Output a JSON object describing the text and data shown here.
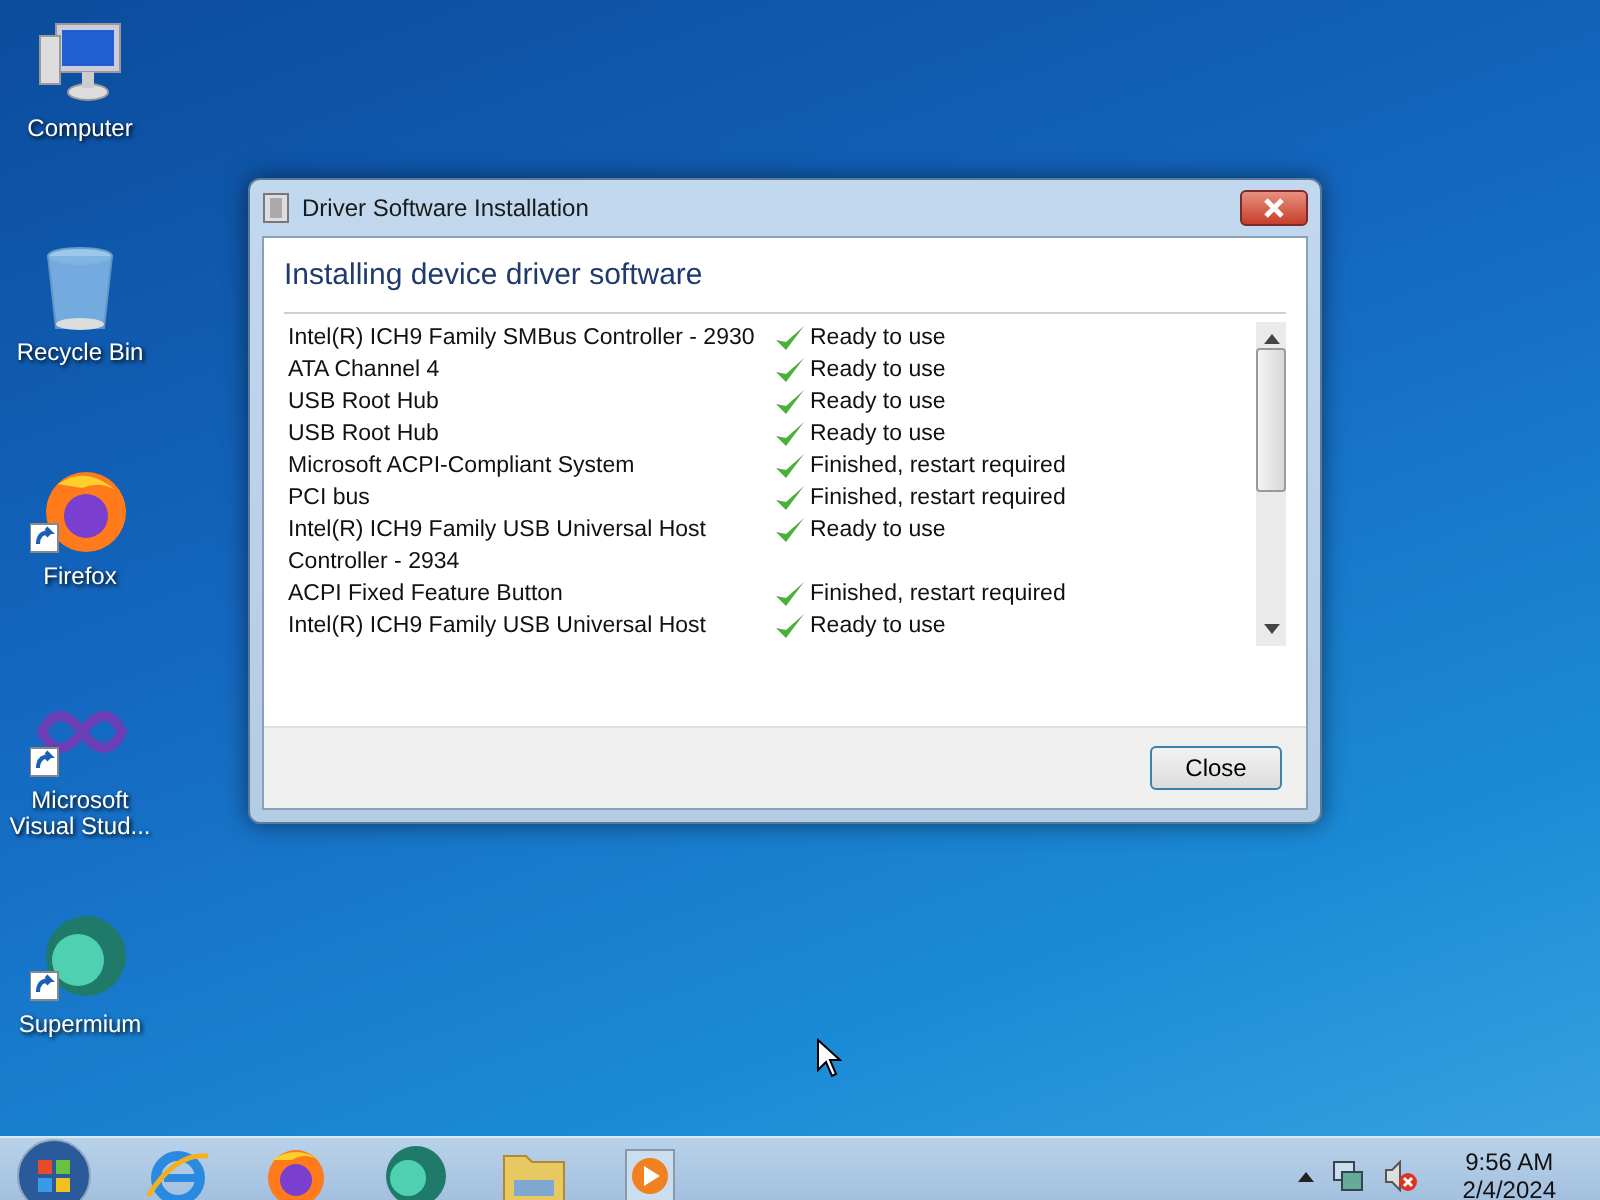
{
  "desktop": {
    "icons": [
      {
        "label": "Computer",
        "kind": "computer",
        "shortcut": false
      },
      {
        "label": "Recycle Bin",
        "kind": "bin",
        "shortcut": false
      },
      {
        "label": "Firefox",
        "kind": "firefox",
        "shortcut": true
      },
      {
        "label": "Microsoft Visual Stud...",
        "kind": "infinity",
        "shortcut": true
      },
      {
        "label": "Supermium",
        "kind": "sphere",
        "shortcut": true
      }
    ]
  },
  "dialog": {
    "title": "Driver Software Installation",
    "heading": "Installing device driver software",
    "devices": [
      {
        "name": "Intel(R) ICH9 Family SMBus Controller - 2930",
        "status": "Ready to use"
      },
      {
        "name": "ATA Channel 4",
        "status": "Ready to use"
      },
      {
        "name": "USB Root Hub",
        "status": "Ready to use"
      },
      {
        "name": "USB Root Hub",
        "status": "Ready to use"
      },
      {
        "name": "Microsoft ACPI-Compliant System",
        "status": "Finished, restart required"
      },
      {
        "name": "PCI bus",
        "status": "Finished, restart required"
      },
      {
        "name": "Intel(R) ICH9 Family USB Universal Host Controller - 2934",
        "status": "Ready to use"
      },
      {
        "name": "ACPI Fixed Feature Button",
        "status": "Finished, restart required"
      },
      {
        "name": "Intel(R) ICH9 Family USB Universal Host",
        "status": "Ready to use"
      }
    ],
    "buttons": [
      "Close"
    ]
  },
  "taskbar": {
    "pinned": [
      {
        "kind": "ie"
      },
      {
        "kind": "firefox"
      },
      {
        "kind": "sphere"
      },
      {
        "kind": "folder"
      },
      {
        "kind": "media"
      }
    ],
    "time": "9:56 AM",
    "date": "2/4/2024"
  }
}
